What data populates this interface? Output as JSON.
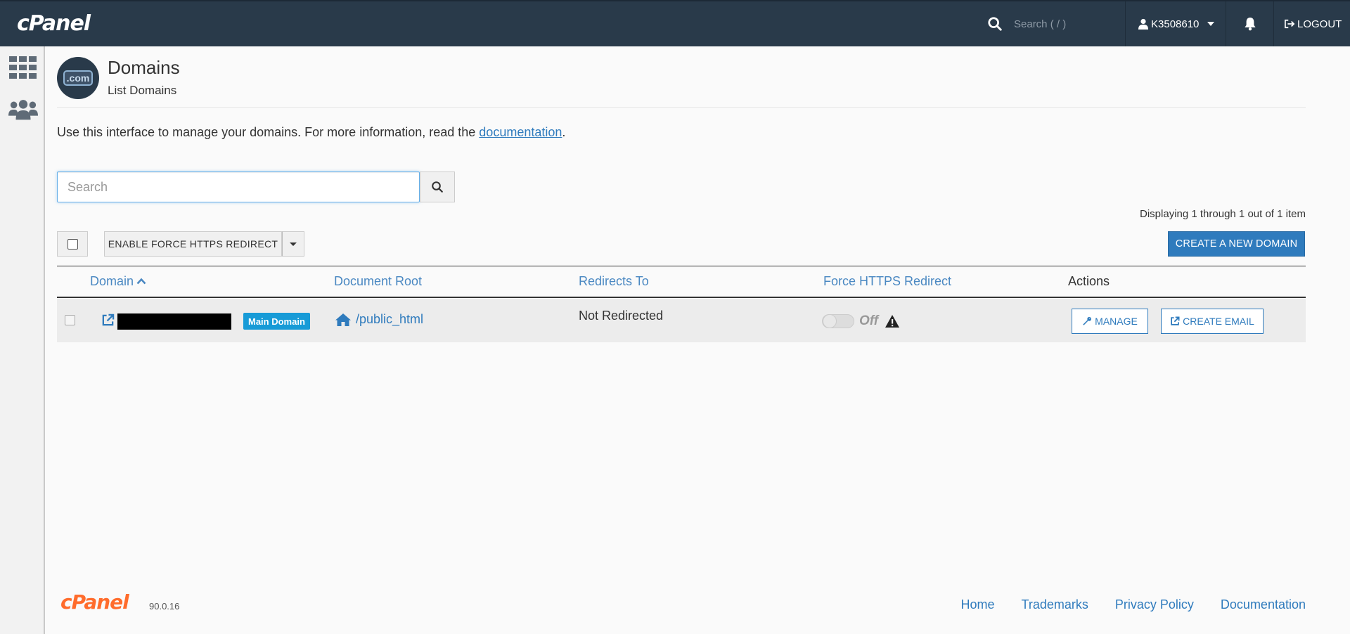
{
  "topbar": {
    "logo": "cPanel",
    "search_placeholder": "Search ( / )",
    "username": "K3508610",
    "logout_label": "LOGOUT"
  },
  "sidebar": {
    "items": [
      {
        "name": "tools",
        "icon": "grid-icon"
      },
      {
        "name": "users",
        "icon": "users-icon"
      }
    ]
  },
  "header": {
    "icon_text": ".com",
    "title": "Domains",
    "subtitle": "List Domains"
  },
  "intro": {
    "text": "Use this interface to manage your domains. For more information, read the ",
    "link": "documentation",
    "suffix": "."
  },
  "search": {
    "placeholder": "Search"
  },
  "displaying": "Displaying 1 through 1 out of 1 item",
  "toolbar": {
    "force_https_label": "ENABLE FORCE HTTPS REDIRECT",
    "create_domain_label": "CREATE A NEW DOMAIN"
  },
  "table": {
    "columns": [
      "Domain",
      "Document Root",
      "Redirects To",
      "Force HTTPS Redirect",
      "Actions"
    ],
    "sort_column": "Domain",
    "sort_direction": "ascending",
    "rows": [
      {
        "badge": "Main Domain",
        "document_root": "/public_html",
        "redirects_to": "Not Redirected",
        "force_https": "Off",
        "manage_label": "MANAGE",
        "email_label": "CREATE EMAIL"
      }
    ]
  },
  "footer": {
    "logo": "cPanel",
    "version": "90.0.16",
    "links": [
      "Home",
      "Trademarks",
      "Privacy Policy",
      "Documentation"
    ]
  },
  "colors": {
    "topbar": "#293a4a",
    "accent": "#2f7bbd",
    "badge": "#179bd7",
    "footer_logo": "#ff6c2c"
  }
}
